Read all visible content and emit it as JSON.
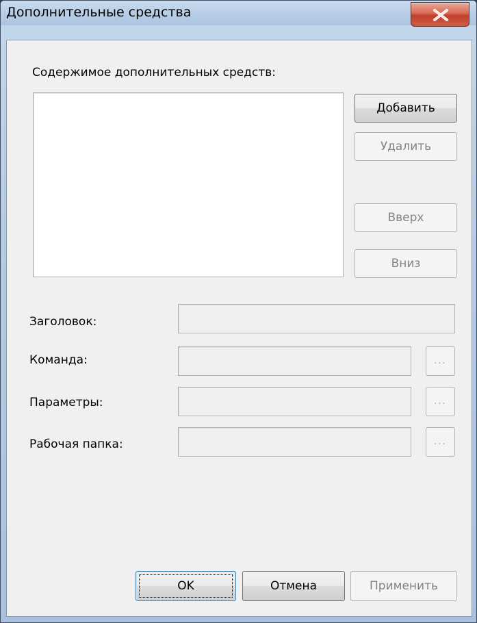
{
  "window": {
    "title": "Дополнительные средства",
    "close_icon": "close-icon"
  },
  "dialog": {
    "list_label": "Содержимое дополнительных средств:",
    "buttons": {
      "add": "Добавить",
      "remove": "Удалить",
      "up": "Вверх",
      "down": "Вниз"
    },
    "fields": {
      "title_label": "Заголовок:",
      "command_label": "Команда:",
      "parameters_label": "Параметры:",
      "workdir_label": "Рабочая папка:",
      "browse_label": "..."
    },
    "footer": {
      "ok": "OK",
      "cancel": "Отмена",
      "apply": "Применить"
    }
  }
}
